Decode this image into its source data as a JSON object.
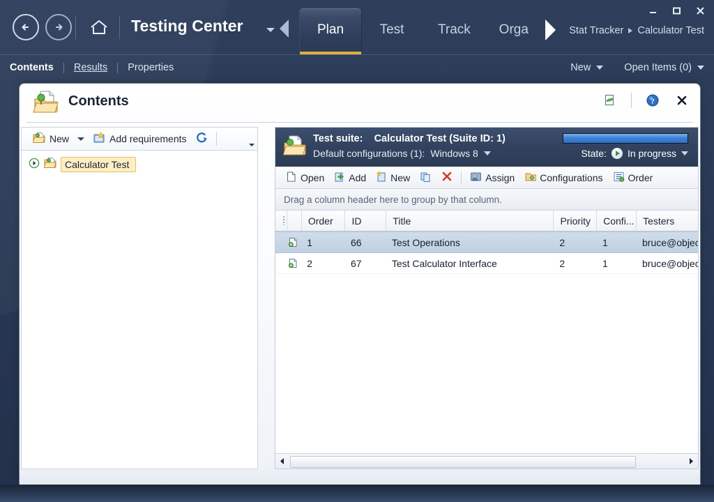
{
  "window": {
    "minimize_label": "Minimize",
    "maximize_label": "Maximize",
    "close_label": "Close"
  },
  "topnav": {
    "back_icon": "arrow-left-circle-icon",
    "forward_icon": "arrow-right-circle-icon",
    "home_icon": "home-icon",
    "app_title": "Testing Center",
    "title_caret_icon": "caret-down-icon",
    "tab_scroll_left_icon": "triangle-left-icon",
    "tab_scroll_right_icon": "triangle-right-icon",
    "tabs": [
      {
        "label": "Plan",
        "active": true
      },
      {
        "label": "Test",
        "active": false
      },
      {
        "label": "Track",
        "active": false
      },
      {
        "label": "Orga",
        "active": false
      }
    ],
    "breadcrumb": {
      "root": "Stat Tracker",
      "separator_icon": "breadcrumb-arrow-icon",
      "current": "Calculator Test"
    }
  },
  "subbar": {
    "links": [
      {
        "label": "Contents",
        "style": "bold"
      },
      {
        "label": "Results",
        "style": "underline"
      },
      {
        "label": "Properties",
        "style": "plain"
      }
    ],
    "new_label": "New",
    "open_items_label": "Open Items (0)"
  },
  "panel": {
    "icon": "contents-folder-icon",
    "title": "Contents",
    "refresh_icon": "refresh-page-icon",
    "help_icon": "help-circle-icon",
    "close_icon": "close-x-icon"
  },
  "left_pane": {
    "toolbar": {
      "new_label": "New",
      "new_icon": "new-folder-icon",
      "new_caret_icon": "caret-down-icon",
      "add_requirements_label": "Add requirements",
      "add_requirements_icon": "add-requirements-icon",
      "refresh_icon": "refresh-arrow-icon",
      "overflow_icon": "toolbar-overflow-icon"
    },
    "tree": [
      {
        "expander_icon": "expand-play-icon",
        "node_icon": "suite-folder-icon",
        "label": "Calculator Test",
        "selected": true
      }
    ]
  },
  "right_pane": {
    "suite": {
      "icon": "suite-folder-icon",
      "label": "Test suite:",
      "name": "Calculator Test (Suite ID: 1)",
      "configurations_label": "Default configurations (1):",
      "configuration_value": "Windows 8",
      "configuration_caret_icon": "caret-down-icon",
      "progress_percent": 100,
      "progress_color": "#3b82d8",
      "state_label": "State:",
      "state_icon": "in-progress-play-icon",
      "state_value": "In progress",
      "state_caret_icon": "caret-down-icon"
    },
    "toolbar": [
      {
        "label": "Open",
        "icon": "open-document-icon"
      },
      {
        "label": "Add",
        "icon": "add-test-icon"
      },
      {
        "label": "New",
        "icon": "new-test-icon"
      },
      {
        "label": "",
        "icon": "copy-icon"
      },
      {
        "label": "",
        "icon": "delete-x-icon"
      },
      {
        "label": "Assign",
        "icon": "assign-user-icon"
      },
      {
        "label": "Configurations",
        "icon": "configurations-icon"
      },
      {
        "label": "Order",
        "icon": "order-list-icon"
      }
    ],
    "group_bar_text": "Drag a column header here to group by that column.",
    "grid": {
      "columns": [
        "Order",
        "ID",
        "Title",
        "Priority",
        "Confi...",
        "Testers"
      ],
      "rows": [
        {
          "row_icon": "test-case-icon",
          "order": "1",
          "id": "66",
          "title": "Test Operations",
          "priority": "2",
          "configurations": "1",
          "testers": "bruce@objec",
          "selected": true
        },
        {
          "row_icon": "test-case-icon",
          "order": "2",
          "id": "67",
          "title": "Test Calculator Interface",
          "priority": "2",
          "configurations": "1",
          "testers": "bruce@objec",
          "selected": false
        }
      ]
    },
    "hscroll": {
      "left_arrow_icon": "scroll-left-arrow-icon",
      "right_arrow_icon": "scroll-right-arrow-icon"
    }
  }
}
